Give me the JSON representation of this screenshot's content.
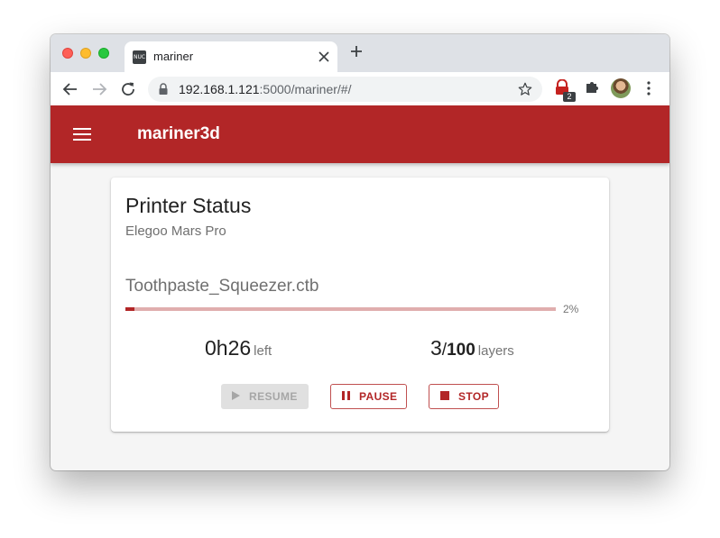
{
  "browser": {
    "tab": {
      "favicon_text": "NUC",
      "title": "mariner"
    },
    "url": {
      "host": "192.168.1.121",
      "rest": ":5000/mariner/#/"
    },
    "extension_badge": "2"
  },
  "app": {
    "title": "mariner3d",
    "accent_color": "#b22627"
  },
  "status": {
    "title": "Printer Status",
    "printer": "Elegoo Mars Pro",
    "filename": "Toothpaste_Squeezer.ctb",
    "progress_percent": 2,
    "progress_label": "2%",
    "time_left": "0h26",
    "time_left_suffix": "left",
    "layer_current": "3",
    "layer_total": "100",
    "layer_separator": "/",
    "layers_suffix": "layers"
  },
  "controls": {
    "resume": "RESUME",
    "pause": "PAUSE",
    "stop": "STOP"
  }
}
